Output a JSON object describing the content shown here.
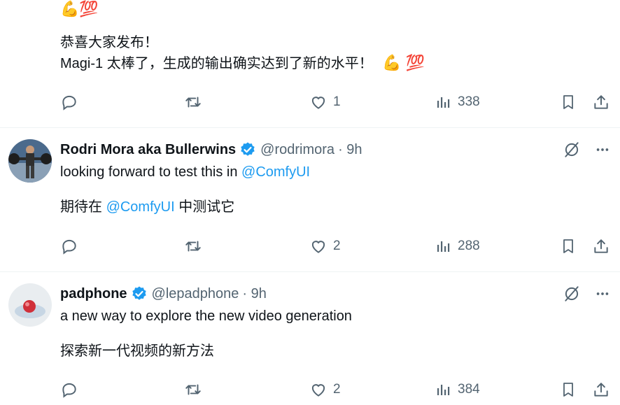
{
  "post1": {
    "top_emoji": "💪💯",
    "line1": "恭喜大家发布！",
    "line2": "Magi-1 太棒了，生成的输出确实达到了新的水平！",
    "line2_emoji": "💪 💯",
    "like_count": "1",
    "views": "338"
  },
  "post2": {
    "name": "Rodri Mora aka Bullerwins",
    "handle": "@rodrimora",
    "time": "· 9h",
    "text_prefix": "looking forward to test this in ",
    "mention": "@ComfyUI",
    "cn_prefix": "期待在 ",
    "cn_mention": "@ComfyUI",
    "cn_suffix": " 中测试它",
    "like_count": "2",
    "views": "288"
  },
  "post3": {
    "name": "padphone",
    "handle": "@lepadphone",
    "time": "· 9h",
    "text": "a new way to explore the new video generation",
    "cn_text": "探索新一代视频的新方法",
    "like_count": "2",
    "views": "384"
  },
  "icons": [
    "reply-icon",
    "retweet-icon",
    "like-icon",
    "views-icon",
    "bookmark-icon",
    "share-icon",
    "verified-icon",
    "grok-icon",
    "more-icon"
  ],
  "colors": {
    "accent": "#1d9bf0",
    "muted": "#536471",
    "text": "#0f1419"
  }
}
